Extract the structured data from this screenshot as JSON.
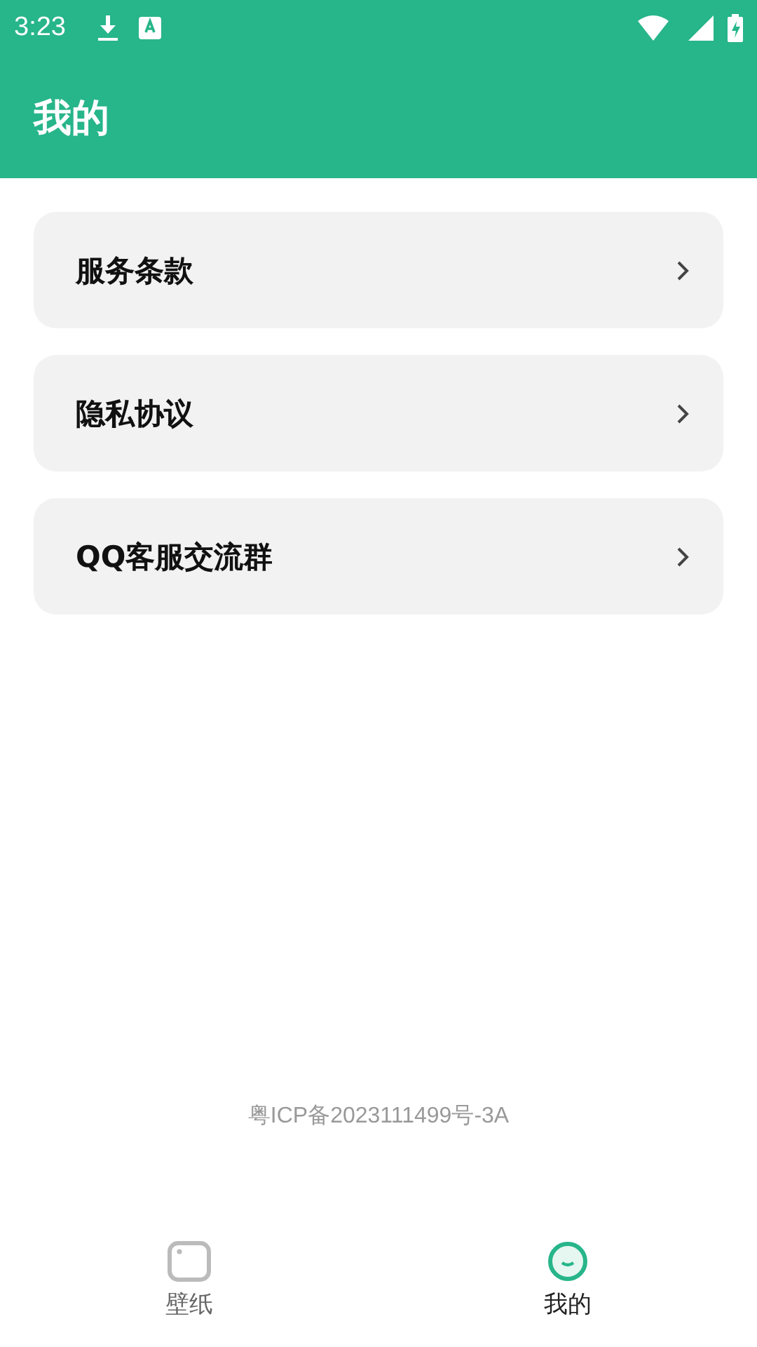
{
  "status_bar": {
    "time": "3:23"
  },
  "header": {
    "title": "我的"
  },
  "menu_items": [
    {
      "label": "服务条款"
    },
    {
      "label": "隐私协议"
    },
    {
      "label": "QQ客服交流群"
    }
  ],
  "footer": {
    "icp": "粤ICP备2023111499号-3A"
  },
  "bottom_nav": [
    {
      "label": "壁纸",
      "selected": false
    },
    {
      "label": "我的",
      "selected": true
    }
  ]
}
